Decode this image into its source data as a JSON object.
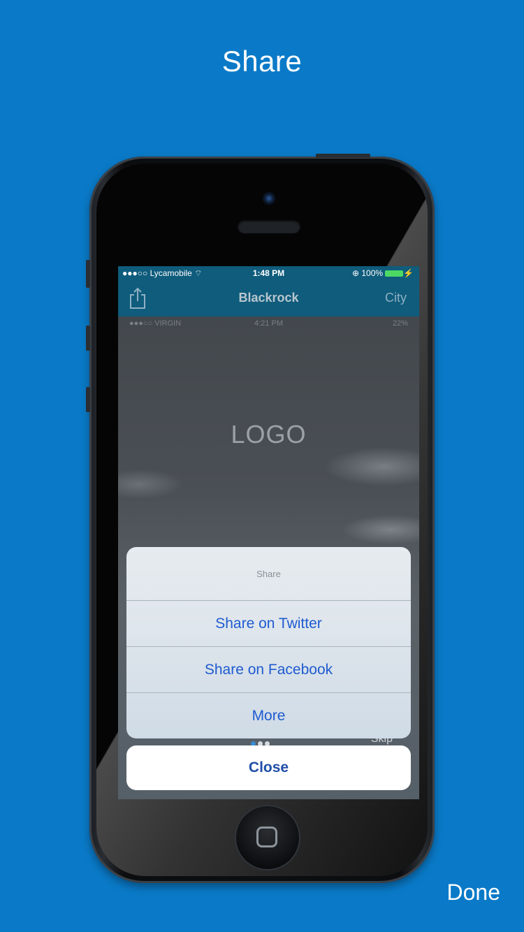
{
  "page": {
    "title": "Share",
    "done_label": "Done"
  },
  "status_bar": {
    "carrier": "●●●○○ Lycamobile ",
    "time": "1:48 PM",
    "battery": "⊕ 100%"
  },
  "nav_bar": {
    "title": "Blackrock",
    "right_label": "City",
    "left_icon": "share-icon"
  },
  "inner_status_bar": {
    "carrier": "●●●○○ VIRGIN",
    "time": "4:21 PM",
    "battery": "22%"
  },
  "content": {
    "logo_text": "LOGO",
    "skip_label": "Skip"
  },
  "action_sheet": {
    "title": "Share",
    "items": [
      {
        "label": "Share on Twitter"
      },
      {
        "label": "Share on Facebook"
      },
      {
        "label": "More"
      }
    ],
    "cancel_label": "Close"
  },
  "colors": {
    "background": "#0a7ac8",
    "nav_bar": "#0f5c7c",
    "action_text": "#1f5bd0"
  }
}
